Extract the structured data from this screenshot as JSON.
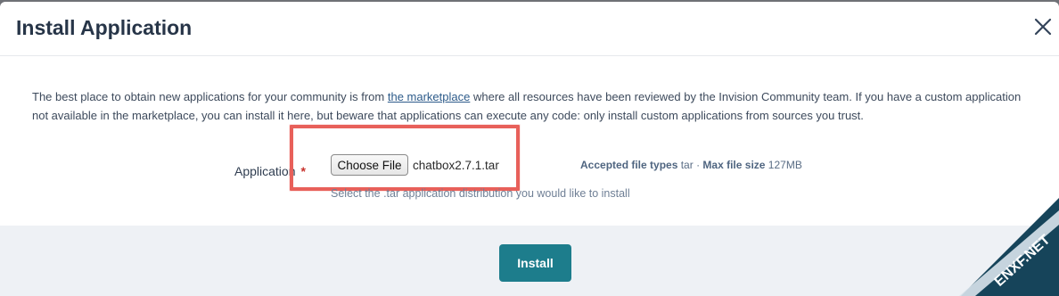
{
  "modal": {
    "title": "Install Application",
    "close_icon": "close-icon"
  },
  "intro": {
    "text_before": "The best place to obtain new applications for your community is from ",
    "link_text": "the marketplace",
    "text_after": " where all resources have been reviewed by the Invision Community team. If you have a custom application not available in the marketplace, you can install it here, but beware that applications can execute any code: only install custom applications from sources you trust."
  },
  "form": {
    "field_label": "Application",
    "required_mark": "*",
    "choose_button": "Choose File",
    "file_name": "chatbox2.7.1.tar",
    "accepted_label": "Accepted file types",
    "accepted_value": "tar",
    "separator": "·",
    "max_size_label": "Max file size",
    "max_size_value": "127MB",
    "hint": "Select the .tar application distribution you would like to install"
  },
  "footer": {
    "install_button": "Install"
  },
  "watermark": {
    "text": "ENXF.NET"
  },
  "colors": {
    "accent": "#1d7d8c",
    "highlight": "#e8605a",
    "link": "#2d5b8a"
  }
}
